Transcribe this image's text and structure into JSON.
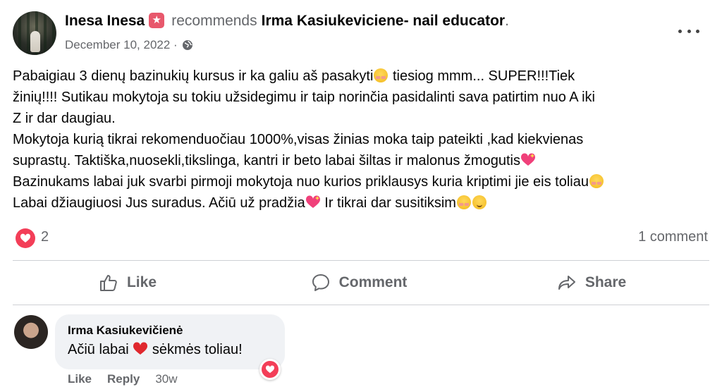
{
  "post": {
    "author": "Inesa Inesa",
    "action": "recommends",
    "page": "Irma Kasiukeviciene- nail educator",
    "page_suffix": ".",
    "date": "December 10, 2022 ·",
    "privacy_icon": "globe-icon",
    "badge_icon": "star-badge-icon",
    "text": {
      "l1a": "Pabaigiau 3 dienų bazinukių kursus ir ka galiu aš pasakyti",
      "l1b": " tiesiog mmm... SUPER!!!Tiek",
      "l2": "žinių!!!! Sutikau mokytoja su tokiu užsidegimu ir taip norinčia pasidalinti  sava patirtim nuo A iki",
      "l3": "Z  ir dar daugiau.",
      "l4": "Mokytoja kurią tikrai rekomenduočiau 1000%,visas žinias moka taip pateikti ,kad kiekvienas",
      "l5": "suprastų. Taktiška,nuosekli,tikslinga, kantri ir beto labai šiltas ir malonus žmogutis",
      "l6": "Bazinukams labai juk svarbi pirmoji mokytoja nuo kurios priklausys kuria kriptimi jie eis toliau",
      "l7a": "Labai džiaugiuosi Jus suradus. Ačiū už pradžia",
      "l7b": " Ir tikrai dar susitiksim"
    }
  },
  "stats": {
    "reaction_icon": "love-reaction-icon",
    "reaction_count": "2",
    "comment_count": "1 comment"
  },
  "actions": {
    "like": "Like",
    "comment": "Comment",
    "share": "Share"
  },
  "comment": {
    "author": "Irma Kasiukevičienė",
    "text_a": "Ačiū labai ",
    "text_b": " sėkmės toliau!",
    "like": "Like",
    "reply": "Reply",
    "time": "30w"
  },
  "colors": {
    "accent_red": "#f33e58",
    "muted": "#65676b",
    "bubble": "#f0f2f5"
  }
}
